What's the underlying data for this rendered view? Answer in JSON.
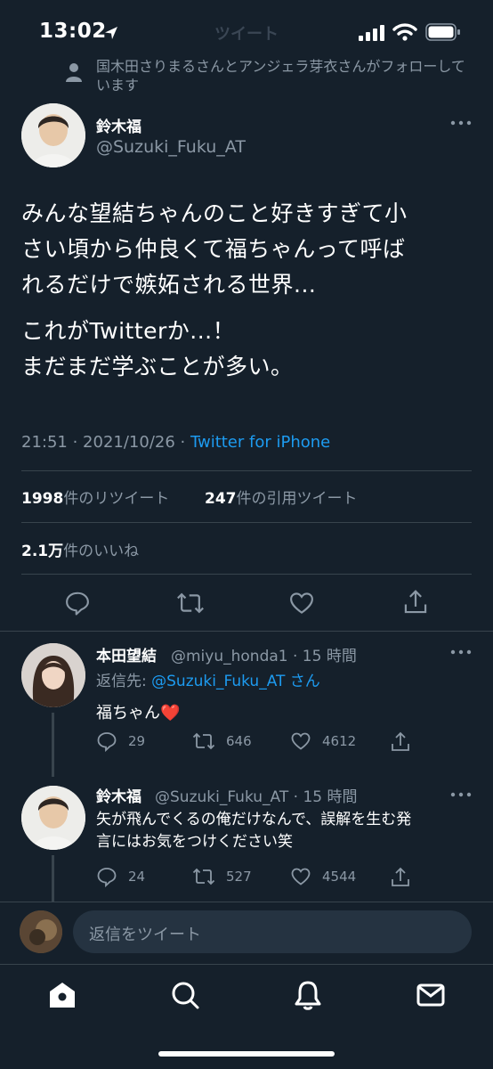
{
  "status": {
    "time": "13:02"
  },
  "nav": {
    "title": "ツイート"
  },
  "social_context": "国木田さりまるさんとアンジェラ芽衣さんがフォローしています",
  "main_tweet": {
    "author_name": "鈴木福",
    "handle": "@Suzuki_Fuku_AT",
    "text_lines": [
      "みんな望結ちゃんのこと好きすぎて小",
      "さい頃から仲良くて福ちゃんって呼ば",
      "れるだけで嫉妬される世界...",
      "これがTwitterか...！",
      "まだまだ学ぶことが多い。"
    ],
    "meta_time": "21:51 · 2021/10/26 · ",
    "source": "Twitter for iPhone",
    "retweets_count": "1998",
    "retweets_label": "件のリツイート",
    "quotes_count": "247",
    "quotes_label": "件の引用ツイート",
    "likes_count": "2.1万",
    "likes_label": "件のいいね"
  },
  "replies": [
    {
      "author_name": "本田望結",
      "handle_time": "@miyu_honda1 · 15 時間",
      "reply_to_prefix": "返信先: ",
      "reply_to_handle": "@Suzuki_Fuku_AT",
      "reply_to_suffix": " さん",
      "text": "福ちゃん❤️",
      "reply_count": "29",
      "retweet_count": "646",
      "like_count": "4612"
    },
    {
      "author_name": "鈴木福",
      "handle_time": "@Suzuki_Fuku_AT · 15 時間",
      "text_lines": [
        "矢が飛んでくるの俺だけなんで、誤解を生む発",
        "言にはお気をつけください笑"
      ],
      "reply_count": "24",
      "retweet_count": "527",
      "like_count": "4544"
    }
  ],
  "reply_input": {
    "placeholder": "返信をツイート"
  },
  "colors": {
    "background": "#15202b",
    "accent": "#1d9bf0",
    "muted": "#8b98a5",
    "divider": "#38444d",
    "heart": "#e0245e"
  }
}
